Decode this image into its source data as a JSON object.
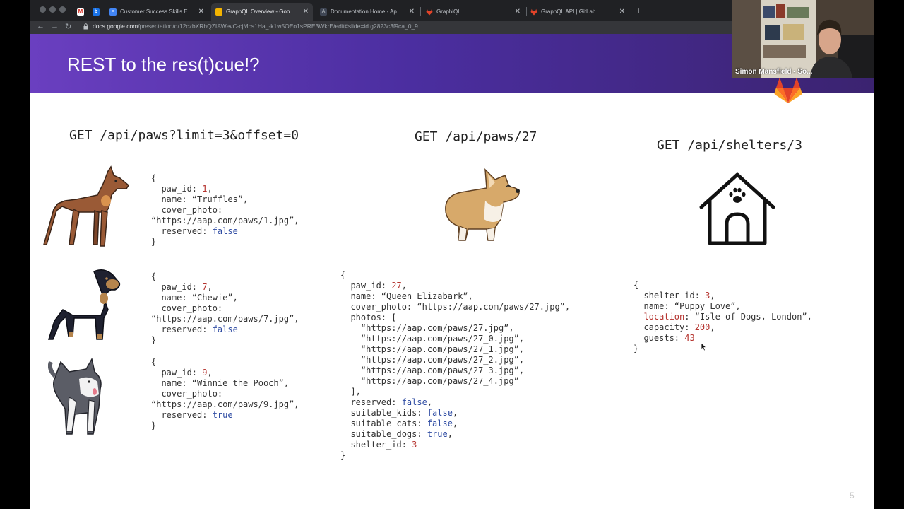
{
  "browser": {
    "tabs": [
      {
        "title": "",
        "favicon": "gmail-icon"
      },
      {
        "title": "",
        "favicon": "bookmark-icon"
      },
      {
        "title": "Customer Success Skills Excha",
        "favicon": "docs-icon",
        "close": "✕"
      },
      {
        "title": "GraphQL Overview - Google Sl",
        "favicon": "slides-icon",
        "close": "✕",
        "active": true
      },
      {
        "title": "Documentation Home - Apollo",
        "favicon": "apollo-icon",
        "close": "✕"
      },
      {
        "title": "GraphiQL",
        "favicon": "gitlab-icon",
        "close": "✕"
      },
      {
        "title": "GraphQL API | GitLab",
        "favicon": "gitlab-icon",
        "close": "✕"
      }
    ],
    "new_tab": "+",
    "url_host": "docs.google.com",
    "url_path": "/presentation/d/12czbXRhQZIAWevC-cjMcs1Ha_-k1w5OEo1sPRE3WkrE/edit#slide=id.g2823c3f9ca_0_9"
  },
  "slide": {
    "title": "REST to the res(t)cue!?",
    "number": "5",
    "columns": [
      {
        "endpoint": "GET /api/paws?limit=3&offset=0",
        "items": [
          {
            "image": "doberman-illustration",
            "paw_id": "1",
            "name": "“Truffles”",
            "cover_photo": "“https://aap.com/paws/1.jpg”",
            "reserved": "false"
          },
          {
            "image": "rottweiler-illustration",
            "paw_id": "7",
            "name": "“Chewie”",
            "cover_photo": "“https://aap.com/paws/7.jpg”",
            "reserved": "false"
          },
          {
            "image": "husky-illustration",
            "paw_id": "9",
            "name": "“Winnie the Pooch”",
            "cover_photo": "“https://aap.com/paws/9.jpg”",
            "reserved": "true"
          }
        ]
      },
      {
        "endpoint": "GET /api/paws/27",
        "image": "corgi-illustration",
        "record": {
          "paw_id": "27",
          "name": "“Queen Elizabark”",
          "cover_photo": "“https://aap.com/paws/27.jpg”",
          "photos": [
            "“https://aap.com/paws/27.jpg”",
            "“https://aap.com/paws/27_0.jpg”",
            "“https://aap.com/paws/27_1.jpg”",
            "“https://aap.com/paws/27_2.jpg”",
            "“https://aap.com/paws/27_3.jpg”",
            "“https://aap.com/paws/27_4.jpg”"
          ],
          "reserved": "false",
          "suitable_kids": "false",
          "suitable_cats": "false",
          "suitable_dogs": "true",
          "shelter_id": "3"
        }
      },
      {
        "endpoint": "GET /api/shelters/3",
        "image": "doghouse-paw-icon",
        "record": {
          "shelter_id": "3",
          "name": "“Puppy Love”",
          "location": "“Isle of Dogs, London”",
          "capacity": "200",
          "guests": "43"
        }
      }
    ]
  },
  "webcam": {
    "name": "Simon Mansfield - So..."
  },
  "colors": {
    "header_start": "#6a3fc0",
    "header_end": "#3b2370",
    "number_color": "#b5332e",
    "boolean_color": "#2f4ca3"
  }
}
